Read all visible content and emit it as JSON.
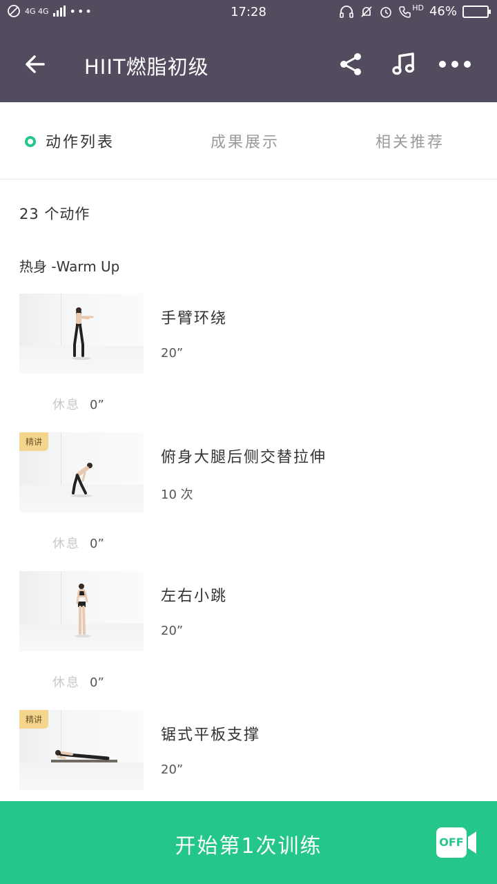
{
  "status_bar": {
    "network": "4G 4G",
    "time": "17:28",
    "hd": "HD",
    "battery_percent": "46%",
    "battery_level": 0.46
  },
  "header": {
    "title": "HIIT燃脂初级",
    "icons": [
      "back-arrow-icon",
      "share-icon",
      "music-icon",
      "more-icon"
    ]
  },
  "tabs": [
    {
      "label": "动作列表",
      "active": true
    },
    {
      "label": "成果展示",
      "active": false
    },
    {
      "label": "相关推荐",
      "active": false
    }
  ],
  "content": {
    "count": "23 个动作",
    "section_title": "热身 -Warm Up",
    "items": [
      {
        "name": "手臂环绕",
        "meta": "20”",
        "badge": ""
      },
      {
        "name": "俯身大腿后侧交替拉伸",
        "meta": "10 次",
        "badge": "精讲"
      },
      {
        "name": "左右小跳",
        "meta": "20”",
        "badge": ""
      },
      {
        "name": "锯式平板支撑",
        "meta": "20”",
        "badge": "精讲"
      }
    ],
    "rests": [
      {
        "label": "休息",
        "value": "0”"
      },
      {
        "label": "休息",
        "value": "0”"
      },
      {
        "label": "休息",
        "value": "0”"
      }
    ]
  },
  "footer": {
    "start_label": "开始第1次训练",
    "off_label": "OFF"
  },
  "colors": {
    "header_bg": "#524c5e",
    "accent": "#24c789",
    "badge_bg": "#f5d58e"
  }
}
